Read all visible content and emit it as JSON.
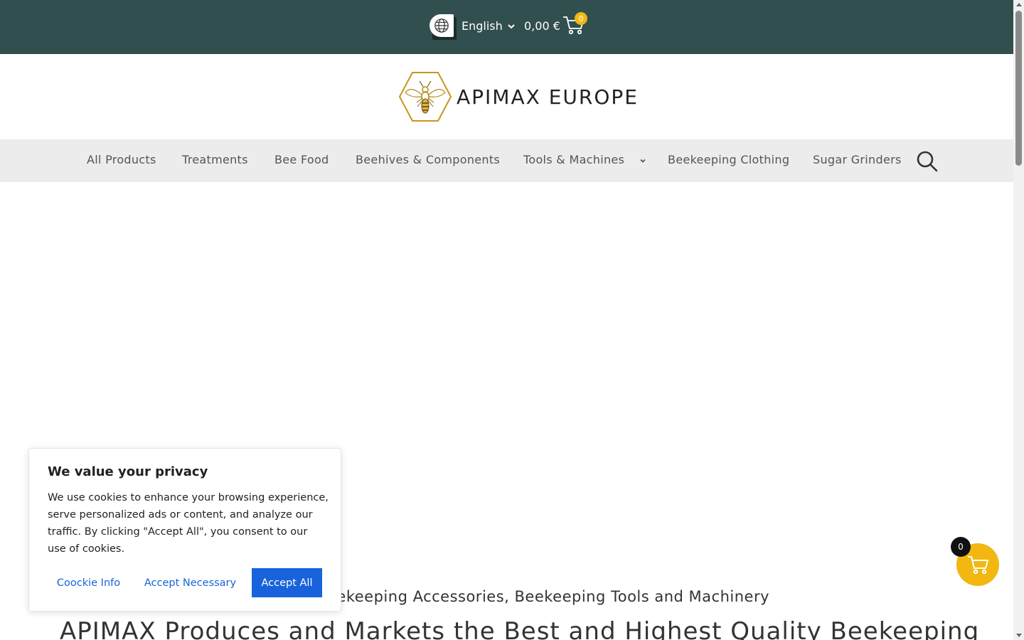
{
  "colors": {
    "topbar": "#324f50",
    "accent": "#f2b711",
    "cookie_button": "#1863dc",
    "nav_background": "#ececec"
  },
  "topbar": {
    "language": "English",
    "cart_total": "0,00 €",
    "cart_count": "0",
    "icons": [
      "globe-icon",
      "chevron-down-icon",
      "cart-icon"
    ]
  },
  "logo": {
    "text": "APIMAX EUROPE",
    "icon": "bee-hexagon-logo"
  },
  "nav": {
    "items": [
      {
        "label": "All Products"
      },
      {
        "label": "Treatments"
      },
      {
        "label": "Bee Food"
      },
      {
        "label": "Beehives & Components"
      },
      {
        "label": "Tools & Machines"
      },
      {
        "label": "Beekeeping Clothing"
      },
      {
        "label": "Sugar Grinders"
      }
    ],
    "search_icon": "search-icon"
  },
  "hero": {
    "subheading": "eekeeping Accessories, Beekeeping Tools and Machinery",
    "headline": "APIMAX Produces and Markets the Best and Highest Quality Beekeeping"
  },
  "cookie": {
    "title": "We value your privacy",
    "text": "We use cookies to enhance your browsing experience, serve personalized ads or content, and analyze our traffic. By clicking \"Accept All\", you consent to our use of cookies.",
    "info_label": "Coockie Info",
    "necessary_label": "Accept Necessary",
    "accept_label": "Accept All"
  },
  "floating_cart": {
    "count": "0",
    "icon": "cart-icon"
  }
}
